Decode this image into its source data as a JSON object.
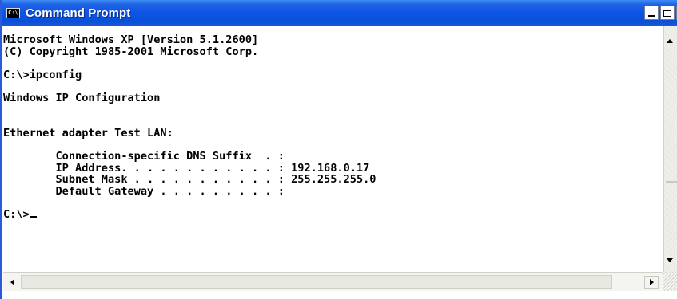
{
  "window": {
    "title": "Command Prompt",
    "icon": "console-icon",
    "icon_text": "C:\\"
  },
  "titlebar_buttons": {
    "minimize": "minimize-icon",
    "maximize": "maximize-icon",
    "close_glyph": "×"
  },
  "console": {
    "lines": [
      "Microsoft Windows XP [Version 5.1.2600]",
      "(C) Copyright 1985-2001 Microsoft Corp.",
      "",
      "C:\\>ipconfig",
      "",
      "Windows IP Configuration",
      "",
      "",
      "Ethernet adapter Test LAN:",
      "",
      "        Connection-specific DNS Suffix  . :",
      "        IP Address. . . . . . . . . . . . : 192.168.0.17",
      "        Subnet Mask . . . . . . . . . . . : 255.255.255.0",
      "        Default Gateway . . . . . . . . . :",
      ""
    ],
    "prompt": "C:\\>"
  },
  "colors": {
    "titlebar": "#0c55e5",
    "console_bg": "#ffffff",
    "console_text": "#000000"
  }
}
